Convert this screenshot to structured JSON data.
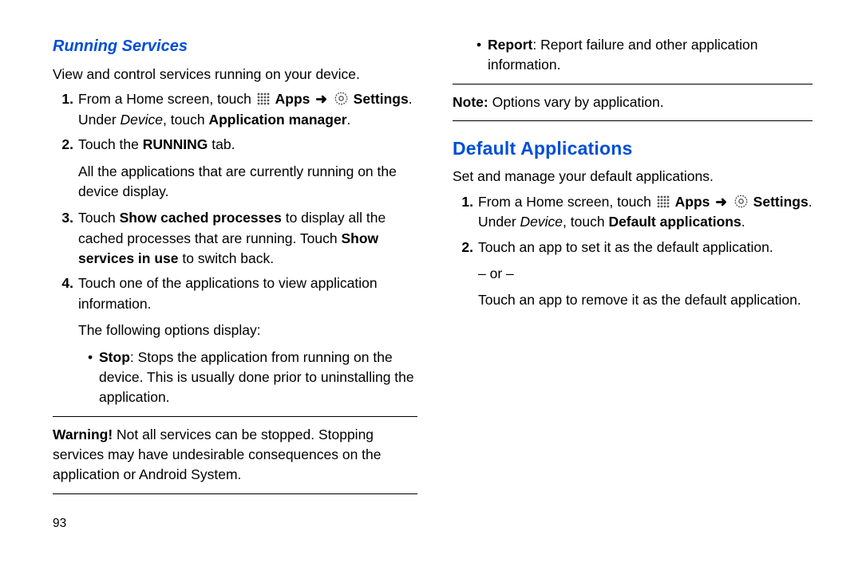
{
  "pageNumber": "93",
  "running": {
    "heading": "Running Services",
    "intro": "View and control services running on your device.",
    "step1_prefix": "From a Home screen, touch ",
    "apps_label": "Apps",
    "arrow": "➜",
    "settings_label": "Settings",
    "step1_period": ".",
    "under_prefix": "Under ",
    "device_word": "Device",
    "under_mid": ", touch ",
    "app_mgr": "Application manager",
    "under_end": ".",
    "step2_a": "Touch the ",
    "step2_b": "RUNNING",
    "step2_c": " tab.",
    "step2_sub": "All the applications that are currently running on the device display.",
    "step3_a": "Touch ",
    "step3_b": "Show cached processes",
    "step3_c": " to display all the cached processes that are running. Touch ",
    "step3_d": "Show services in use",
    "step3_e": " to switch back.",
    "step4": "Touch one of the applications to view application information.",
    "step4_sub": "The following options display:",
    "bullet_stop_b": "Stop",
    "bullet_stop_txt": ": Stops the application from running on the device. This is usually done prior to uninstalling the application.",
    "warn_label": "Warning!",
    "warn_txt": " Not all services can be stopped. Stopping services may have undesirable consequences on the application or Android System."
  },
  "right_top": {
    "bullet_report_b": "Report",
    "bullet_report_txt": ": Report failure and other application information.",
    "note_label": "Note:",
    "note_txt": " Options vary by application."
  },
  "defapps": {
    "heading": "Default Applications",
    "intro": "Set and manage your default applications.",
    "step1_prefix": "From a Home screen, touch ",
    "apps_label": "Apps",
    "arrow": "➜",
    "settings_label": "Settings",
    "step1_period": ".",
    "under_prefix": "Under ",
    "device_word": "Device",
    "under_mid": ", touch ",
    "default_apps": "Default applications",
    "under_end": ".",
    "step2": "Touch an app to set it as the default application.",
    "or": "– or –",
    "step2_alt": "Touch an app to remove it as the default application."
  }
}
